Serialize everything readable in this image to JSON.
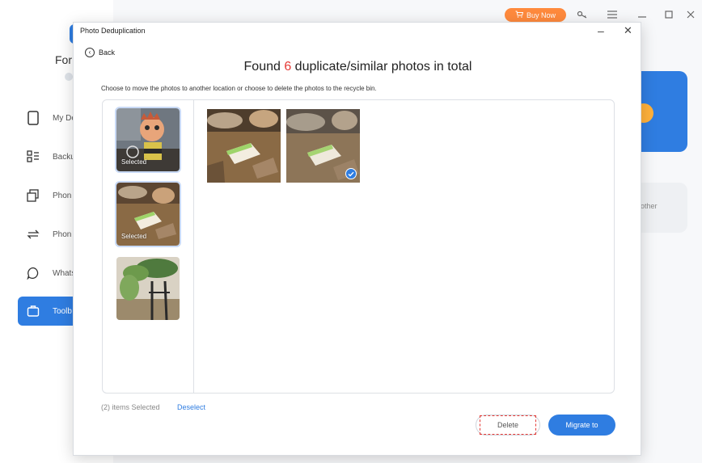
{
  "app": {
    "brand_partial": "For",
    "topbar": {
      "buy_now": "Buy Now"
    },
    "sidebar": {
      "items": [
        {
          "label": "My De",
          "icon": "phone-icon"
        },
        {
          "label": "Backu",
          "icon": "backup-icon"
        },
        {
          "label": "Phon",
          "icon": "copy-icon"
        },
        {
          "label": "Phon",
          "icon": "transfer-icon"
        },
        {
          "label": "Whats",
          "icon": "chat-icon"
        },
        {
          "label": "Toolb",
          "icon": "toolbox-icon",
          "active": true
        }
      ]
    },
    "bg_card_text": "other"
  },
  "dialog": {
    "title": "Photo Deduplication",
    "back_label": "Back",
    "found_prefix": "Found ",
    "found_count": "6",
    "found_suffix": " duplicate/similar photos in total",
    "hint": "Choose to move the photos to another location or choose to delete the photos to the recycle bin.",
    "groups": [
      {
        "label": "Selected",
        "selected": true
      },
      {
        "label": "Selected",
        "selected": true
      },
      {
        "label": "",
        "selected": false
      }
    ],
    "photos": [
      {
        "checked": false
      },
      {
        "checked": true
      }
    ],
    "footer": {
      "items_selected": "(2) items Selected",
      "deselect": "Deselect",
      "delete": "Delete",
      "migrate": "Migrate to"
    }
  },
  "colors": {
    "accent": "#2f7de1",
    "count_red": "#e53935",
    "buy_orange": "#ff8a3d"
  }
}
